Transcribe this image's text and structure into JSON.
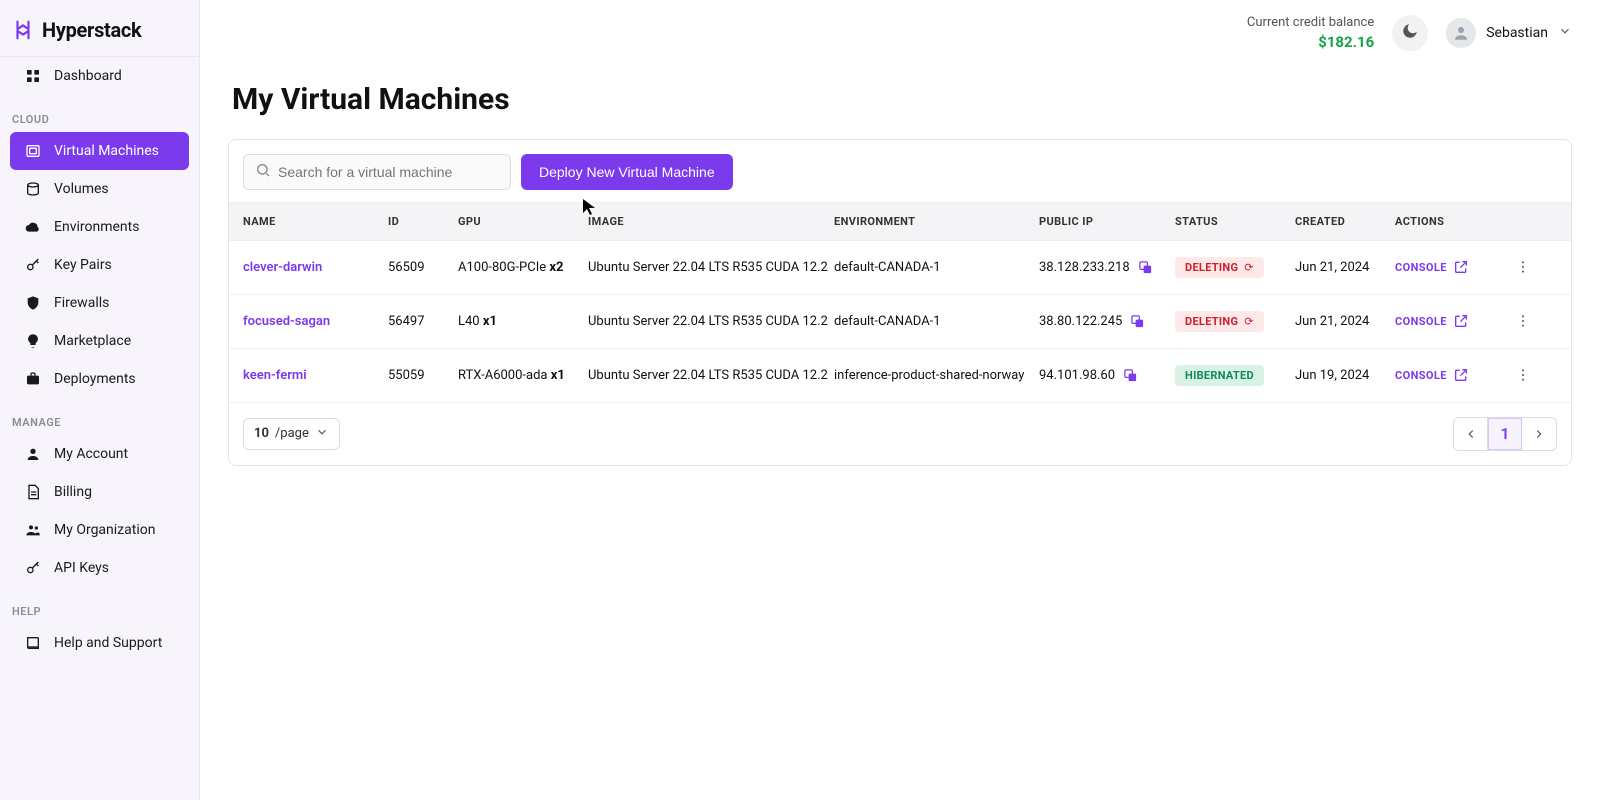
{
  "brand": {
    "name": "Hyperstack"
  },
  "sidebar": {
    "dashboard": "Dashboard",
    "section_cloud": "CLOUD",
    "cloud": [
      {
        "label": "Virtual Machines",
        "active": true
      },
      {
        "label": "Volumes"
      },
      {
        "label": "Environments"
      },
      {
        "label": "Key Pairs"
      },
      {
        "label": "Firewalls"
      },
      {
        "label": "Marketplace"
      },
      {
        "label": "Deployments"
      }
    ],
    "section_manage": "MANAGE",
    "manage": [
      {
        "label": "My Account"
      },
      {
        "label": "Billing"
      },
      {
        "label": "My Organization"
      },
      {
        "label": "API Keys"
      }
    ],
    "section_help": "HELP",
    "help": [
      {
        "label": "Help and Support"
      }
    ]
  },
  "header": {
    "balance_label": "Current credit balance",
    "balance_value": "$182.16",
    "user_name": "Sebastian"
  },
  "page": {
    "title": "My Virtual Machines"
  },
  "toolbar": {
    "search_placeholder": "Search for a virtual machine",
    "deploy_label": "Deploy New Virtual Machine"
  },
  "table": {
    "columns": [
      "NAME",
      "ID",
      "GPU",
      "IMAGE",
      "ENVIRONMENT",
      "PUBLIC IP",
      "STATUS",
      "CREATED",
      "ACTIONS"
    ],
    "console_label": "CONSOLE",
    "rows": [
      {
        "name": "clever-darwin",
        "id": "56509",
        "gpu_model": "A100-80G-PCIe",
        "gpu_count": "x2",
        "image": "Ubuntu Server 22.04 LTS R535 CUDA 12.2",
        "env": "default-CANADA-1",
        "ip": "38.128.233.218",
        "status": "DELETING",
        "status_kind": "deleting",
        "created": "Jun 21, 2024"
      },
      {
        "name": "focused-sagan",
        "id": "56497",
        "gpu_model": "L40",
        "gpu_count": "x1",
        "image": "Ubuntu Server 22.04 LTS R535 CUDA 12.2",
        "env": "default-CANADA-1",
        "ip": "38.80.122.245",
        "status": "DELETING",
        "status_kind": "deleting",
        "created": "Jun 21, 2024"
      },
      {
        "name": "keen-fermi",
        "id": "55059",
        "gpu_model": "RTX-A6000-ada",
        "gpu_count": "x1",
        "image": "Ubuntu Server 22.04 LTS R535 CUDA 12.2",
        "env": "inference-product-shared-norway",
        "ip": "94.101.98.60",
        "status": "HIBERNATED",
        "status_kind": "hibernated",
        "created": "Jun 19, 2024"
      }
    ]
  },
  "footer": {
    "page_size_value": "10",
    "page_size_suffix": "/page",
    "current_page": "1"
  }
}
